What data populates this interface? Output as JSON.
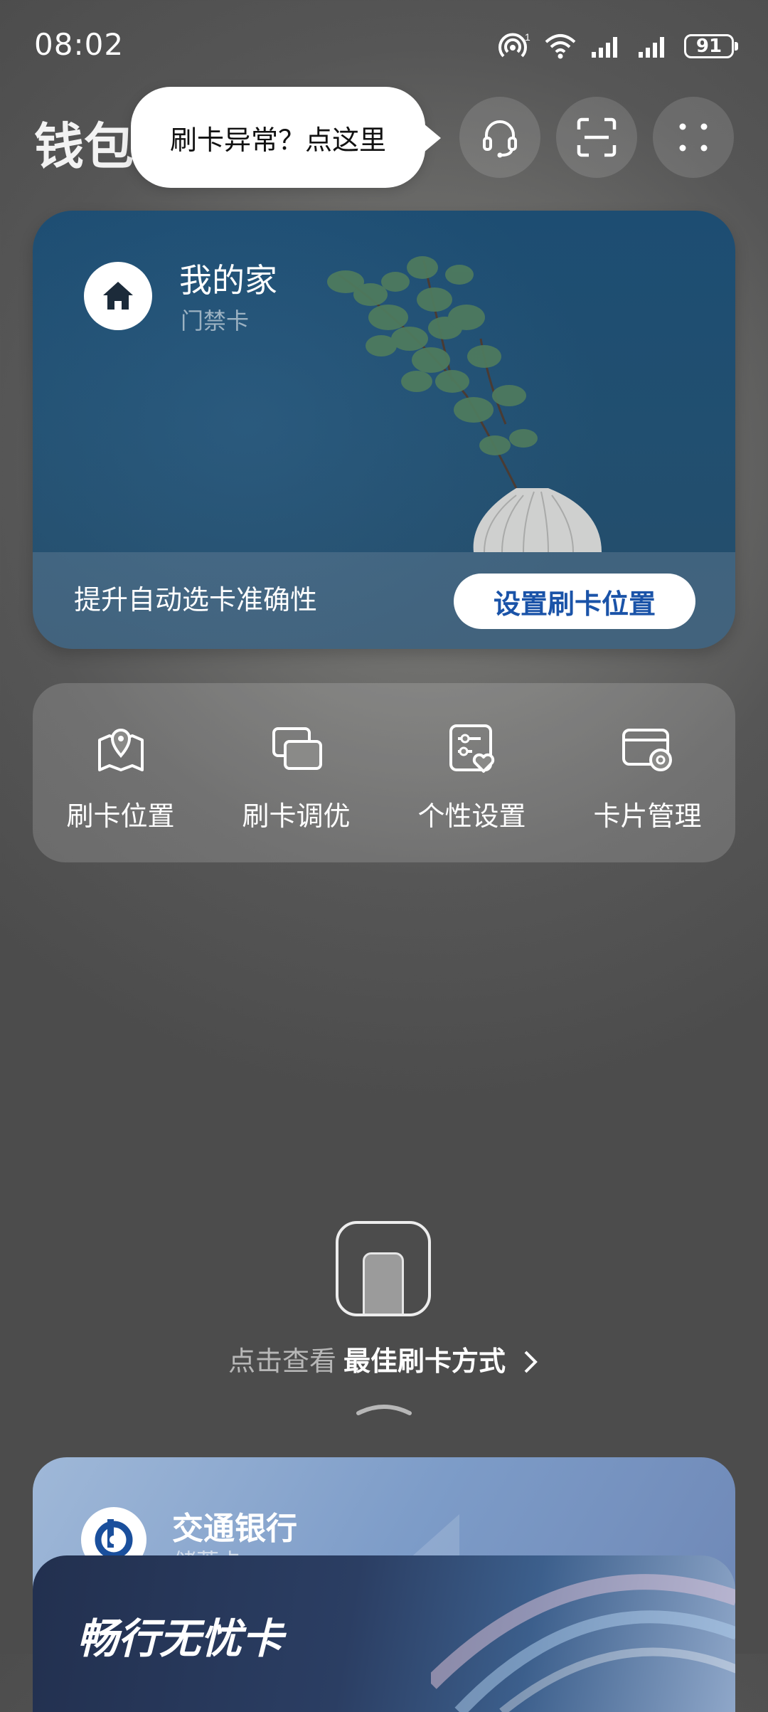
{
  "status_bar": {
    "time": "08:02",
    "battery": "91"
  },
  "header": {
    "title": "钱包",
    "tooltip": "刷卡异常？点这里",
    "icons": [
      "headset-icon",
      "scan-icon",
      "more-icon"
    ]
  },
  "home_card": {
    "name": "我的家",
    "type": "门禁卡",
    "footer_text": "提升自动选卡准确性",
    "button": "设置刷卡位置",
    "accent": "#1a53a8"
  },
  "shortcuts": [
    {
      "label": "刷卡位置",
      "icon": "map-pin-icon"
    },
    {
      "label": "刷卡调优",
      "icon": "cards-icon"
    },
    {
      "label": "个性设置",
      "icon": "personalize-icon"
    },
    {
      "label": "卡片管理",
      "icon": "card-settings-icon"
    }
  ],
  "hint": {
    "prefix": "点击查看",
    "main": "最佳刷卡方式"
  },
  "bank_card": {
    "name": "交通银行",
    "sub": "储蓄卡"
  },
  "travel_card": {
    "name": "畅行无忧卡"
  }
}
